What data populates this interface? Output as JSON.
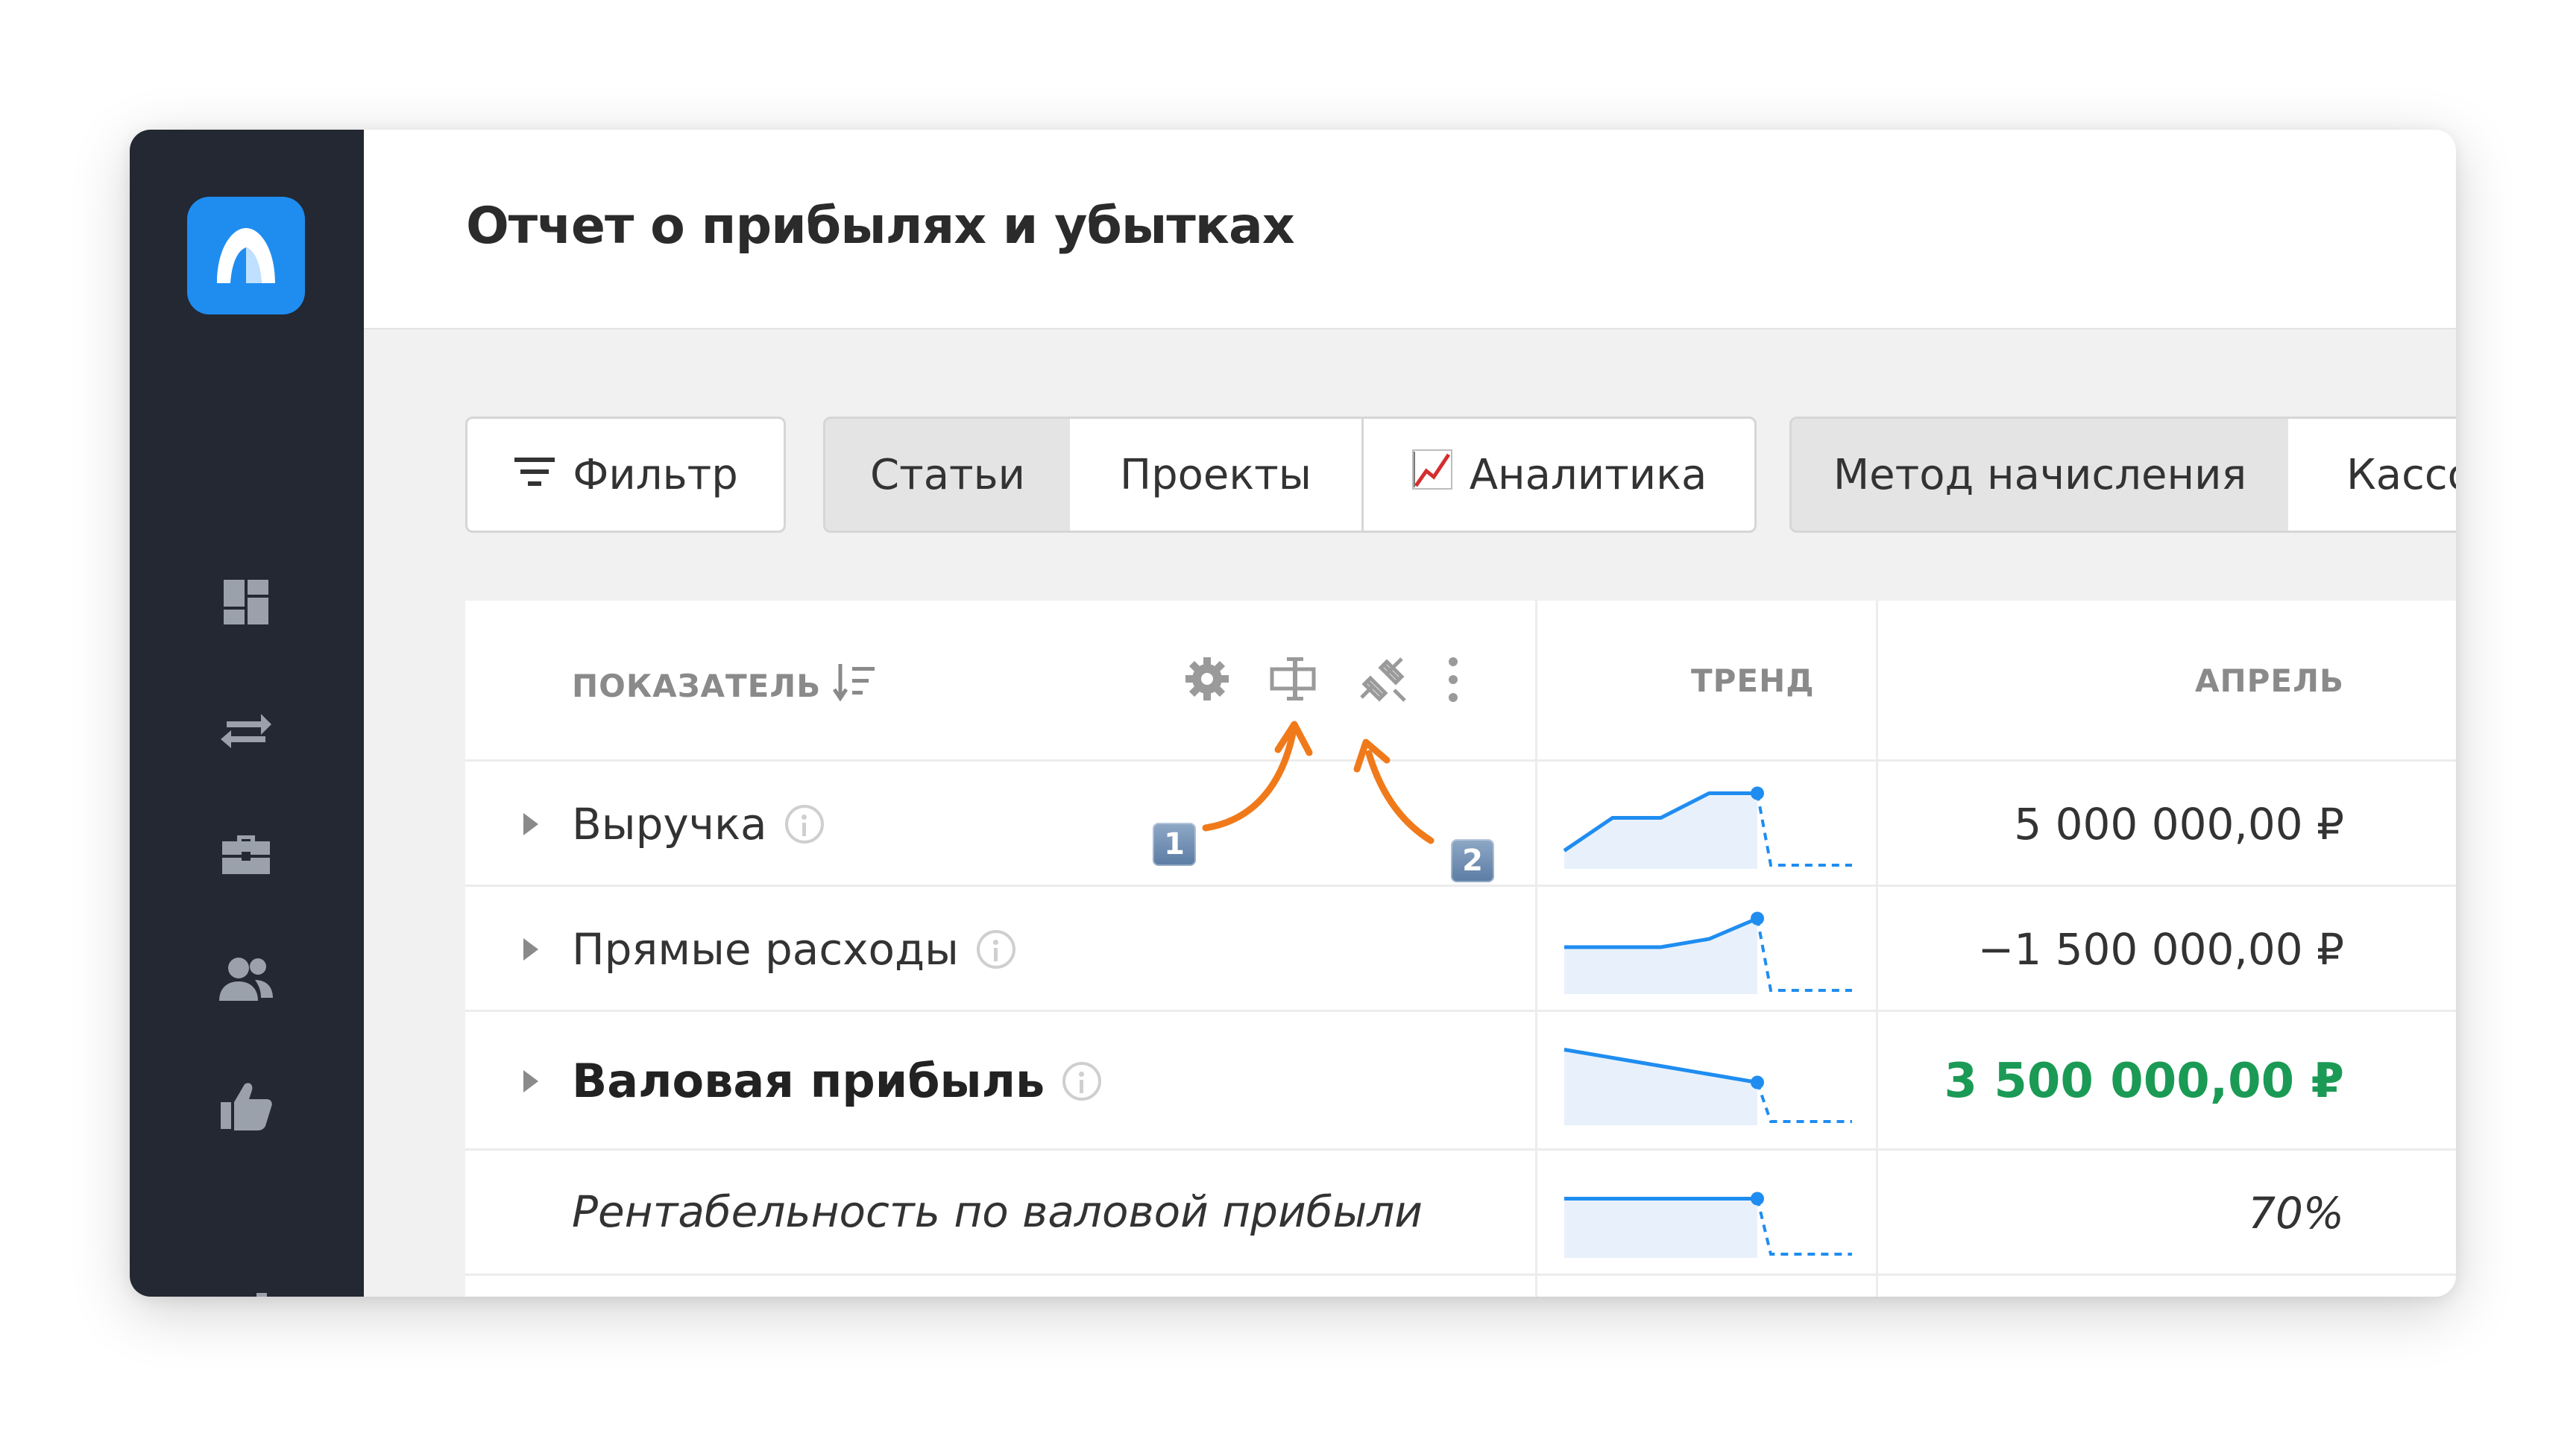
{
  "page": {
    "title": "Отчет о прибылях и убытках"
  },
  "sidebar": {
    "logo": "app-logo",
    "items": [
      {
        "icon": "dashboard-icon"
      },
      {
        "icon": "transfers-icon"
      },
      {
        "icon": "briefcase-icon"
      },
      {
        "icon": "users-icon"
      },
      {
        "icon": "thumbs-up-icon"
      },
      {
        "icon": "bar-chart-icon"
      },
      {
        "icon": "calendar-icon"
      }
    ]
  },
  "toolbar": {
    "filter_label": "Фильтр",
    "group_a": {
      "items": [
        {
          "label": "Статьи",
          "selected": true
        },
        {
          "label": "Проекты",
          "selected": false
        },
        {
          "label": "Аналитика",
          "selected": false,
          "icon": "chart-emoji-icon"
        }
      ]
    },
    "group_b": {
      "items": [
        {
          "label": "Метод начисления",
          "selected": true
        },
        {
          "label": "Кассо",
          "selected": false
        }
      ]
    }
  },
  "table": {
    "columns": {
      "indicator": "ПОКАЗАТЕЛЬ",
      "trend": "ТРЕНД",
      "month": "АПРЕЛЬ"
    },
    "header_icons": [
      "settings-icon",
      "column-width-icon",
      "unlink-icon",
      "more-vertical-icon"
    ],
    "annotations": [
      "1",
      "2"
    ],
    "rows": [
      {
        "label": "Выручка",
        "value": "5 000 000,00 ₽",
        "style": "normal",
        "trend": [
          0.15,
          0.55,
          0.55,
          0.85,
          0.85
        ]
      },
      {
        "label": "Прямые расходы",
        "value": "−1 500 000,00 ₽",
        "style": "normal",
        "trend": [
          0.5,
          0.5,
          0.5,
          0.6,
          0.85
        ]
      },
      {
        "label": "Валовая прибыль",
        "value": "3 500 000,00 ₽",
        "style": "bold",
        "trend": [
          0.85,
          0.75,
          0.65,
          0.55,
          0.45
        ]
      },
      {
        "label": "Рентабельность по валовой прибыли",
        "value": "70%",
        "style": "italic",
        "trend": [
          0.65,
          0.65,
          0.65,
          0.65,
          0.65
        ]
      }
    ]
  },
  "colors": {
    "sidebar_bg": "#232832",
    "accent": "#1f8df0",
    "positive": "#1b9a55",
    "arrow": "#f07a1a"
  }
}
